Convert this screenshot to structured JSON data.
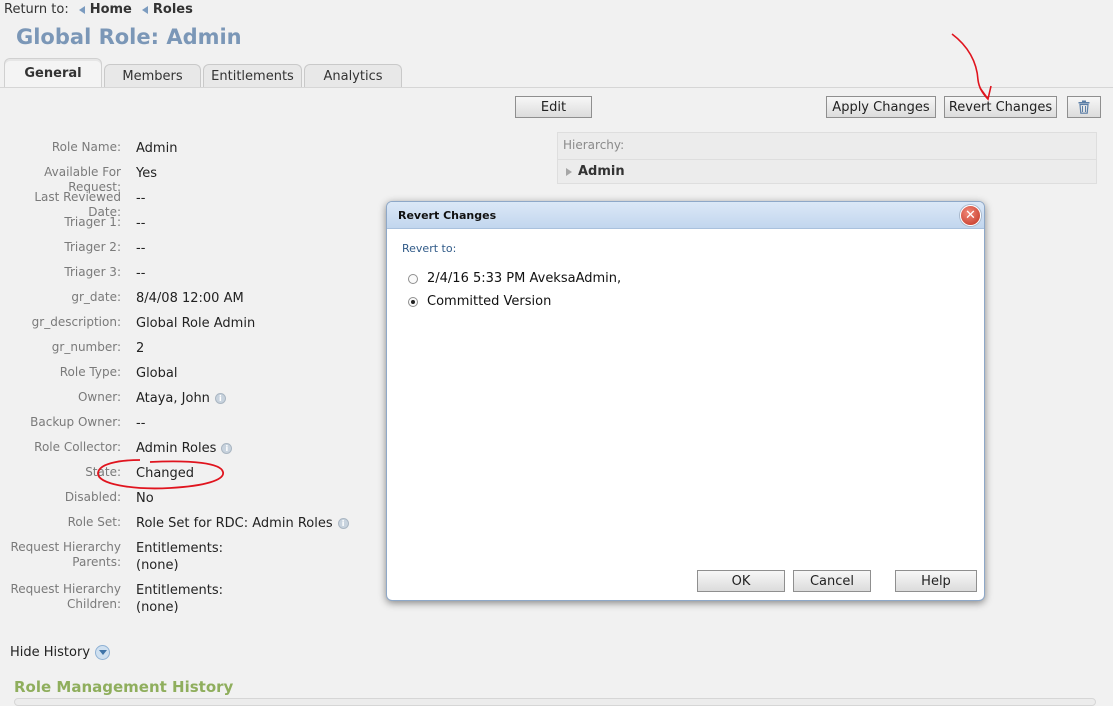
{
  "breadcrumb": {
    "prefix": "Return to:",
    "items": [
      "Home",
      "Roles"
    ]
  },
  "page": {
    "title": "Global Role: Admin"
  },
  "tabs": [
    "General",
    "Members",
    "Entitlements",
    "Analytics"
  ],
  "toolbar": {
    "edit": "Edit",
    "apply": "Apply Changes",
    "revert": "Revert Changes",
    "delete_icon": "trash-icon"
  },
  "properties": [
    {
      "label": "Role Name:",
      "value": "Admin"
    },
    {
      "label": "Available For Request:",
      "value": "Yes"
    },
    {
      "label": "Last Reviewed Date:",
      "value": "--"
    },
    {
      "label": "Triager 1:",
      "value": "--"
    },
    {
      "label": "Triager 2:",
      "value": "--"
    },
    {
      "label": "Triager 3:",
      "value": "--"
    },
    {
      "label": "gr_date:",
      "value": "8/4/08 12:00 AM"
    },
    {
      "label": "gr_description:",
      "value": "Global Role Admin"
    },
    {
      "label": "gr_number:",
      "value": "2"
    },
    {
      "label": "Role Type:",
      "value": "Global"
    },
    {
      "label": "Owner:",
      "value": "Ataya, John"
    },
    {
      "label": "Backup Owner:",
      "value": "--"
    },
    {
      "label": "Role Collector:",
      "value": "Admin Roles"
    },
    {
      "label": "State:",
      "value": "Changed"
    },
    {
      "label": "Disabled:",
      "value": "No"
    },
    {
      "label": "Role Set:",
      "value": "Role Set for RDC: Admin Roles"
    },
    {
      "label_lines": [
        "Request Hierarchy",
        "Parents:"
      ],
      "value_lines": [
        "Entitlements:",
        "(none)"
      ]
    },
    {
      "label_lines": [
        "Request Hierarchy",
        "Children:"
      ],
      "value_lines": [
        "Entitlements:",
        "(none)"
      ]
    }
  ],
  "hierarchy": {
    "label": "Hierarchy:",
    "item": "Admin"
  },
  "history": {
    "toggle": "Hide History",
    "title": "Role Management History"
  },
  "dialog": {
    "title": "Revert Changes",
    "revert_label": "Revert to:",
    "options": [
      "2/4/16 5:33 PM AveksaAdmin,",
      "Committed Version"
    ],
    "selected_index": 1,
    "ok": "OK",
    "cancel": "Cancel",
    "help": "Help"
  },
  "colors": {
    "title": "#7b97b7",
    "history_title": "#8fae5d",
    "annotation": "#e0141e"
  }
}
